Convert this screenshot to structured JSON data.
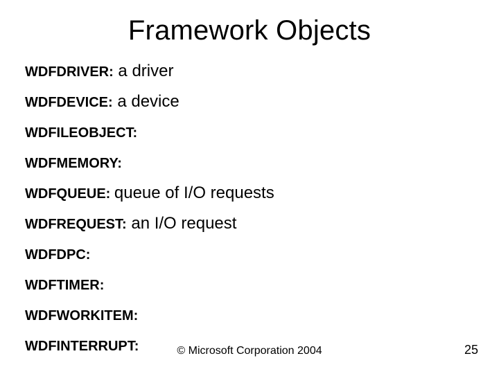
{
  "slide": {
    "title": "Framework Objects",
    "copyright": "© Microsoft Corporation 2004",
    "page_number": "25",
    "objects": [
      {
        "name": "WDFDRIVER:",
        "desc": " a driver"
      },
      {
        "name": "WDFDEVICE:",
        "desc": " a device"
      },
      {
        "name": "WDFILEOBJECT:",
        "desc": ""
      },
      {
        "name": "WDFMEMORY:",
        "desc": ""
      },
      {
        "name": "WDFQUEUE: ",
        "desc": " queue of I/O requests"
      },
      {
        "name": "WDFREQUEST:",
        "desc": " an I/O request"
      },
      {
        "name": "WDFDPC:",
        "desc": ""
      },
      {
        "name": "WDFTIMER:",
        "desc": ""
      },
      {
        "name": "WDFWORKITEM:",
        "desc": ""
      },
      {
        "name": "WDFINTERRUPT:",
        "desc": ""
      }
    ]
  }
}
